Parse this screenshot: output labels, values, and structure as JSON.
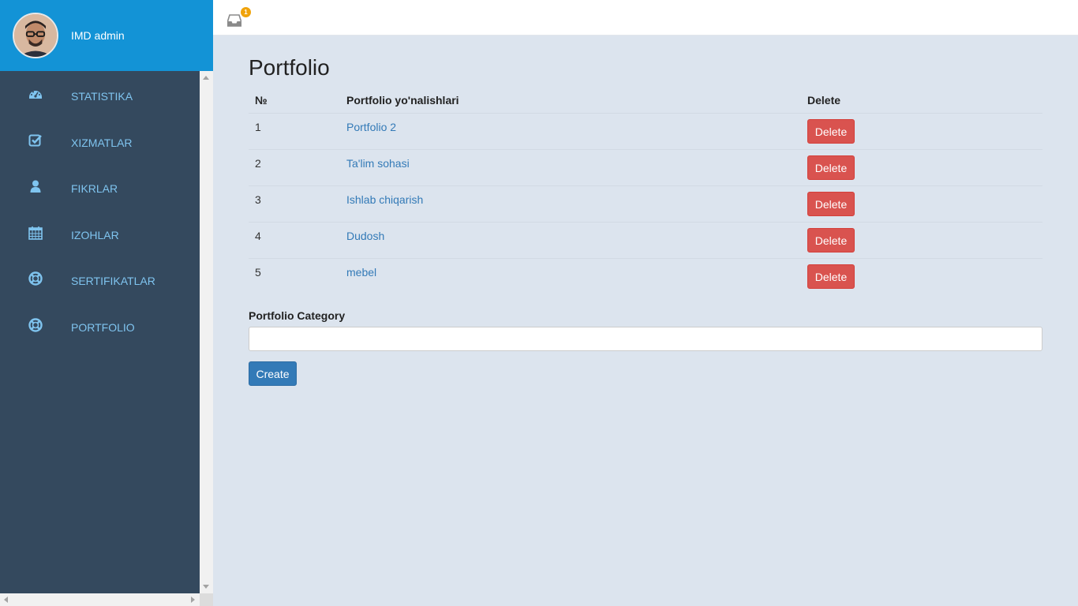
{
  "sidebar": {
    "admin_name": "IMD admin",
    "items": [
      {
        "label": "STATISTIKA",
        "icon": "dashboard-icon"
      },
      {
        "label": "XIZMATLAR",
        "icon": "check-square-icon"
      },
      {
        "label": "FIKRLAR",
        "icon": "user-icon"
      },
      {
        "label": "IZOHLAR",
        "icon": "calendar-icon"
      },
      {
        "label": "SERTIFIKATLAR",
        "icon": "life-ring-icon"
      },
      {
        "label": "PORTFOLIO",
        "icon": "life-ring-icon"
      }
    ]
  },
  "topbar": {
    "notification_count": "1",
    "icon": "inbox-icon"
  },
  "main": {
    "title": "Portfolio",
    "table": {
      "headers": [
        "№",
        "Portfolio yo'nalishlari",
        "Delete"
      ],
      "rows": [
        {
          "num": "1",
          "name": "Portfolio 2",
          "action": "Delete"
        },
        {
          "num": "2",
          "name": "Ta'lim sohasi",
          "action": "Delete"
        },
        {
          "num": "3",
          "name": "Ishlab chiqarish",
          "action": "Delete"
        },
        {
          "num": "4",
          "name": "Dudosh",
          "action": "Delete"
        },
        {
          "num": "5",
          "name": "mebel",
          "action": "Delete"
        }
      ]
    },
    "form": {
      "label": "Portfolio Category",
      "input_value": "",
      "submit_label": "Create"
    }
  },
  "colors": {
    "sidebar_bg": "#34495e",
    "sidebar_header_bg": "#1393d6",
    "nav_text": "#7fc4ef",
    "content_bg": "#dce4ee",
    "link": "#337ab7",
    "danger": "#d9534f",
    "primary": "#337ab7",
    "badge": "#f0a30a"
  }
}
